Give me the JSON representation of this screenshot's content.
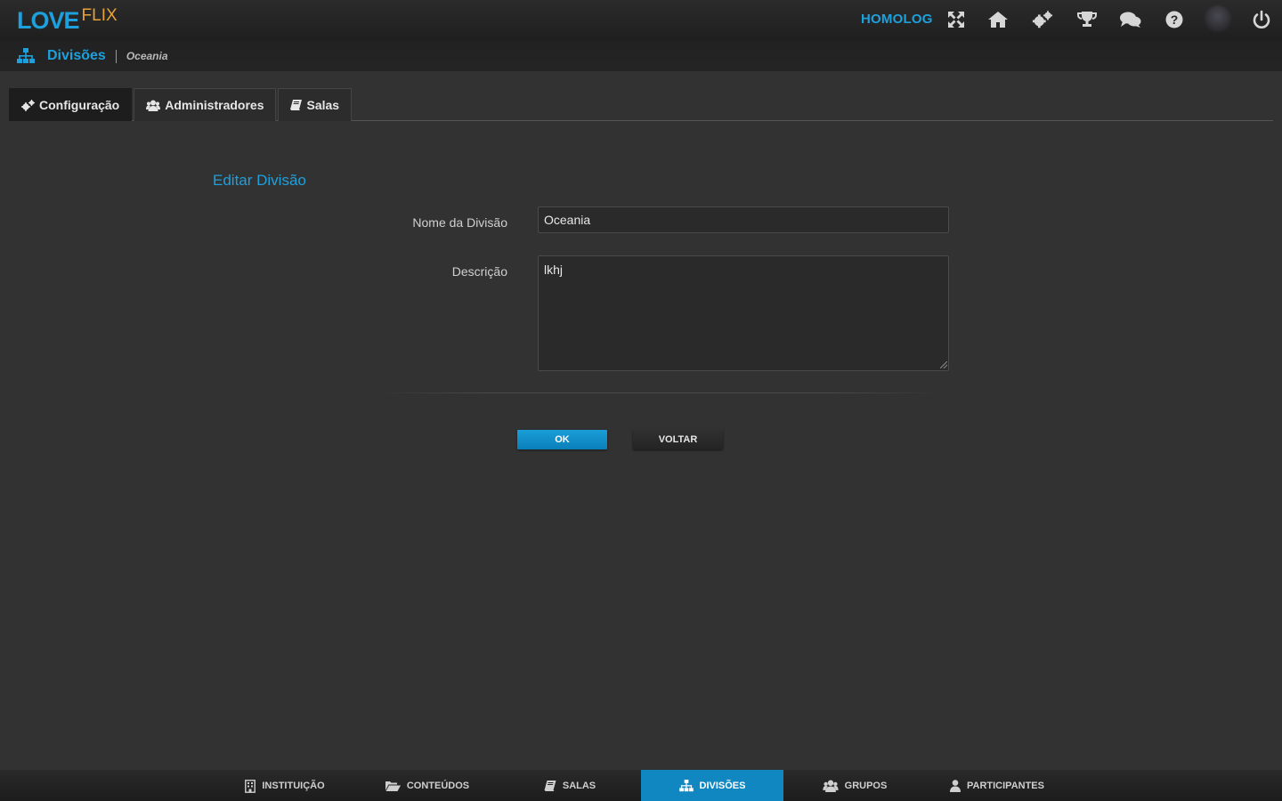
{
  "app": {
    "logo_primary": "LOVE",
    "logo_secondary": "FLIX",
    "environment": "HOMOLOG",
    "accent_color": "#1ea0dc",
    "logo_secondary_color": "#e8a23a"
  },
  "header": {
    "icons": [
      "fullscreen-icon",
      "home-icon",
      "settings-icon",
      "trophy-icon",
      "chat-icon",
      "help-icon",
      "avatar",
      "power-icon"
    ]
  },
  "breadcrumb": {
    "section": "Divisões",
    "current": "Oceania"
  },
  "tabs": [
    {
      "label": "Configuração",
      "icon": "cogs-icon",
      "active": true
    },
    {
      "label": "Administradores",
      "icon": "users-icon",
      "active": false
    },
    {
      "label": "Salas",
      "icon": "book-icon",
      "active": false
    }
  ],
  "form": {
    "title": "Editar Divisão",
    "name_label": "Nome da Divisão",
    "name_value": "Oceania",
    "description_label": "Descrição",
    "description_value": "lkhj",
    "ok_label": "OK",
    "back_label": "VOLTAR"
  },
  "bottom_nav": [
    {
      "label": "INSTITUIÇÃO",
      "icon": "building-icon",
      "active": false
    },
    {
      "label": "CONTEÚDOS",
      "icon": "folder-open-icon",
      "active": false
    },
    {
      "label": "SALAS",
      "icon": "book-icon",
      "active": false
    },
    {
      "label": "DIVISÕES",
      "icon": "sitemap-icon",
      "active": true
    },
    {
      "label": "GRUPOS",
      "icon": "users-icon",
      "active": false
    },
    {
      "label": "PARTICIPANTES",
      "icon": "user-icon",
      "active": false
    }
  ]
}
